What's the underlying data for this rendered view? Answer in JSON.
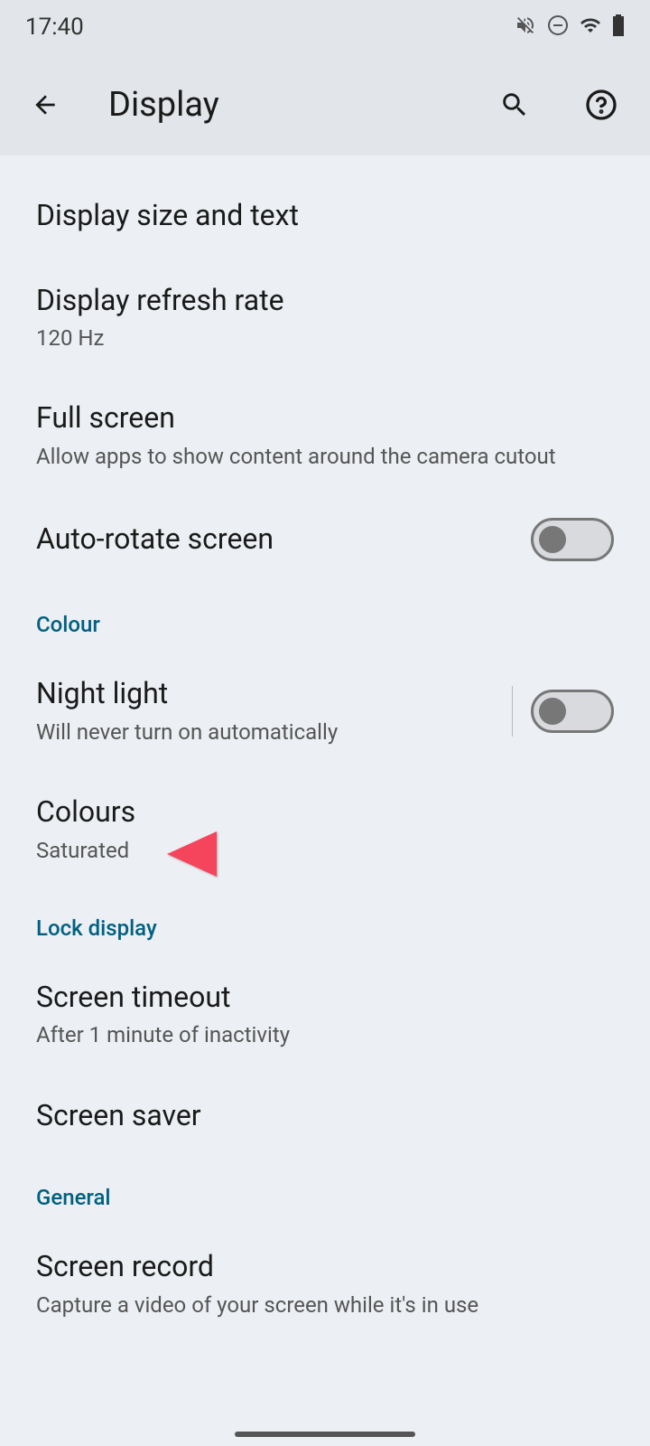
{
  "statusBar": {
    "time": "17:40"
  },
  "appBar": {
    "title": "Display"
  },
  "settings": {
    "displaySizeText": {
      "title": "Display size and text"
    },
    "refreshRate": {
      "title": "Display refresh rate",
      "subtitle": "120 Hz"
    },
    "fullScreen": {
      "title": "Full screen",
      "subtitle": "Allow apps to show content around the camera cutout"
    },
    "autoRotate": {
      "title": "Auto-rotate screen",
      "enabled": false
    },
    "nightLight": {
      "title": "Night light",
      "subtitle": "Will never turn on automatically",
      "enabled": false
    },
    "colours": {
      "title": "Colours",
      "subtitle": "Saturated"
    },
    "screenTimeout": {
      "title": "Screen timeout",
      "subtitle": "After 1 minute of inactivity"
    },
    "screenSaver": {
      "title": "Screen saver"
    },
    "screenRecord": {
      "title": "Screen record",
      "subtitle": "Capture a video of your screen while it's in use"
    }
  },
  "sections": {
    "colour": "Colour",
    "lockDisplay": "Lock display",
    "general": "General"
  }
}
